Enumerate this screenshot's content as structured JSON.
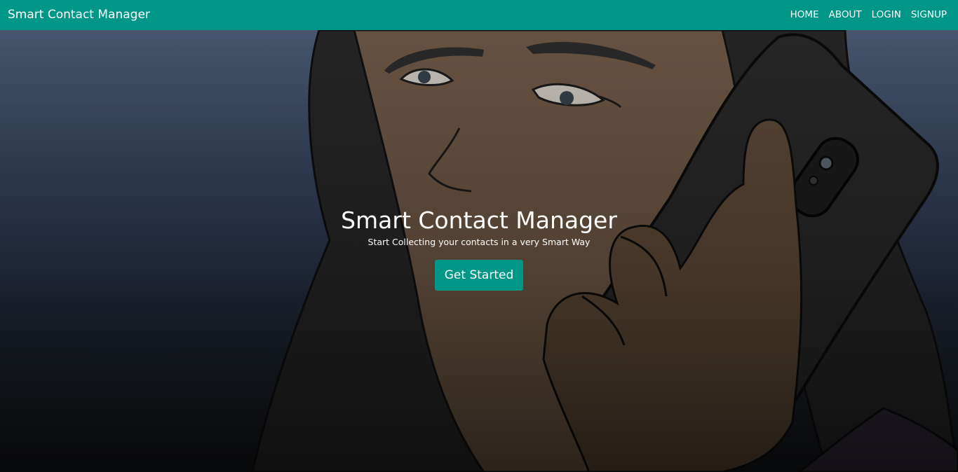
{
  "app": {
    "brand": "Smart Contact Manager",
    "accent_color": "#009688"
  },
  "nav": {
    "links": [
      "HOME",
      "ABOUT",
      "LOGIN",
      "SIGNUP"
    ]
  },
  "hero": {
    "title": "Smart Contact Manager",
    "subtitle": "Start Collecting your contacts in a very Smart Way",
    "cta_label": "Get Started",
    "background_illustration": "woman-talking-on-phone-illustration"
  }
}
